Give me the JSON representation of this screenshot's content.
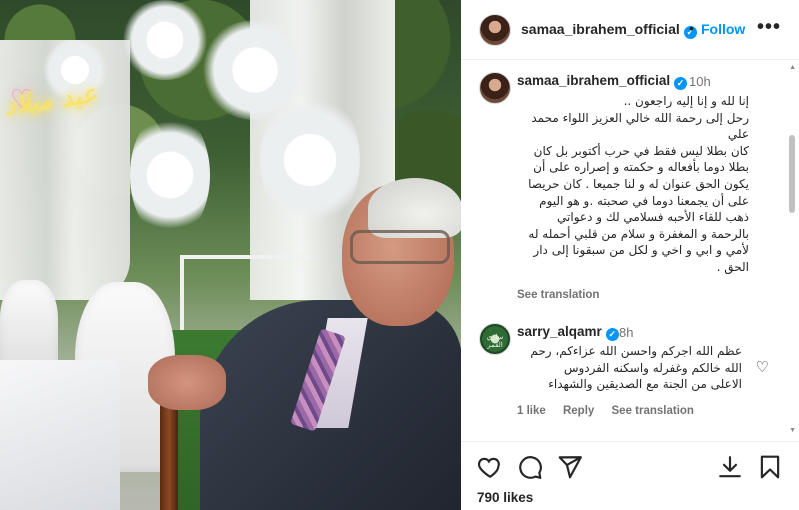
{
  "header": {
    "username": "samaa_ibrahem_official",
    "verified": true,
    "follow_label": "Follow",
    "separator": "•",
    "more_label": "•••"
  },
  "caption": {
    "username": "samaa_ibrahem_official",
    "time": "10h",
    "lines": [
      "إنا لله و إنا إليه راجعون ..",
      "رحل إلى رحمة الله خالي العزيز اللواء محمد",
      "علي",
      "كان بطلا ليس فقط في حرب أكتوبر بل كان",
      "بطلا دوما بأفعاله و حكمته و إصراره على أن",
      "يكون الحق عنوان له و لنا جميعا . كان حريصا",
      "على أن يجمعنا دوما في صحبته .و هو اليوم",
      "ذهب للقاء الأحبه فسلامي لك و دعواتي",
      "بالرحمة و المغفرة و سلام من قلبي أحمله له",
      "لأمي و ابي و اخي و لكل من سبقونا إلى دار",
      "الحق ."
    ],
    "see_translation": "See translation"
  },
  "comment": {
    "username": "sarry_alqamr",
    "time": "8h",
    "avatar_text": "ساري القمر",
    "lines": [
      "عظم الله اجركم واحسن الله عزاءكم، رحم",
      "الله خالكم وغفرله واسكنه الفردوس",
      "الاعلى من الجنة مع الصديقين والشهداء"
    ],
    "likes": "1 like",
    "reply": "Reply",
    "see_translation": "See translation"
  },
  "footer": {
    "likes": "790 likes"
  },
  "photo": {
    "neon_text": "عيد ميلاد"
  },
  "icons": [
    "heart-icon",
    "comment-icon",
    "share-icon",
    "save-icon",
    "more-icon",
    "verified-icon"
  ],
  "colors": {
    "accent": "#0095f6",
    "muted": "#737373",
    "text": "#262626"
  }
}
